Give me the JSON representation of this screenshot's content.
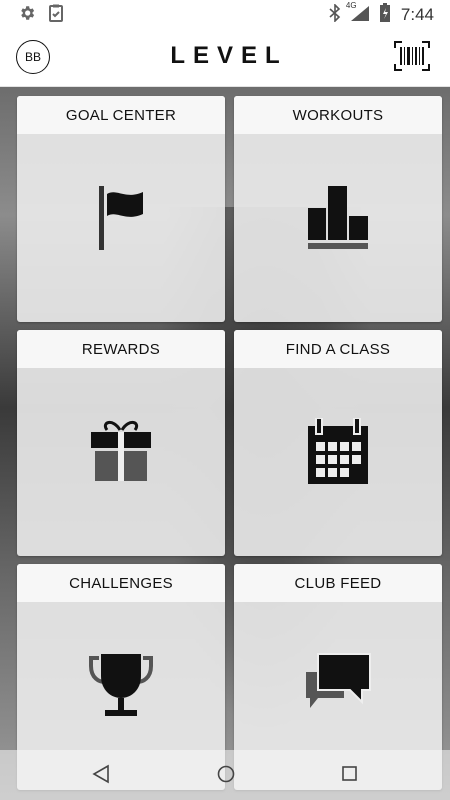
{
  "status_bar": {
    "left_icons": [
      "gear-icon",
      "clipboard-check-icon"
    ],
    "right_icons": [
      "bluetooth-icon",
      "signal-4g-icon",
      "battery-icon"
    ],
    "network_label": "4G",
    "time": "7:44"
  },
  "header": {
    "avatar_initials": "BB",
    "brand": "LEVEL",
    "barcode_icon": "barcode-scan-icon"
  },
  "tiles": [
    {
      "label": "GOAL CENTER",
      "icon": "flag-icon"
    },
    {
      "label": "WORKOUTS",
      "icon": "bar-chart-icon"
    },
    {
      "label": "REWARDS",
      "icon": "gift-icon"
    },
    {
      "label": "FIND A CLASS",
      "icon": "calendar-icon"
    },
    {
      "label": "CHALLENGES",
      "icon": "trophy-icon"
    },
    {
      "label": "CLUB FEED",
      "icon": "chat-bubbles-icon"
    }
  ],
  "nav_bar": {
    "buttons": [
      "back-triangle-icon",
      "home-circle-icon",
      "recents-square-icon"
    ]
  },
  "colors": {
    "icon": "#111111",
    "tile_header": "#f7f7f7",
    "tile_body": "#ebebeb"
  }
}
